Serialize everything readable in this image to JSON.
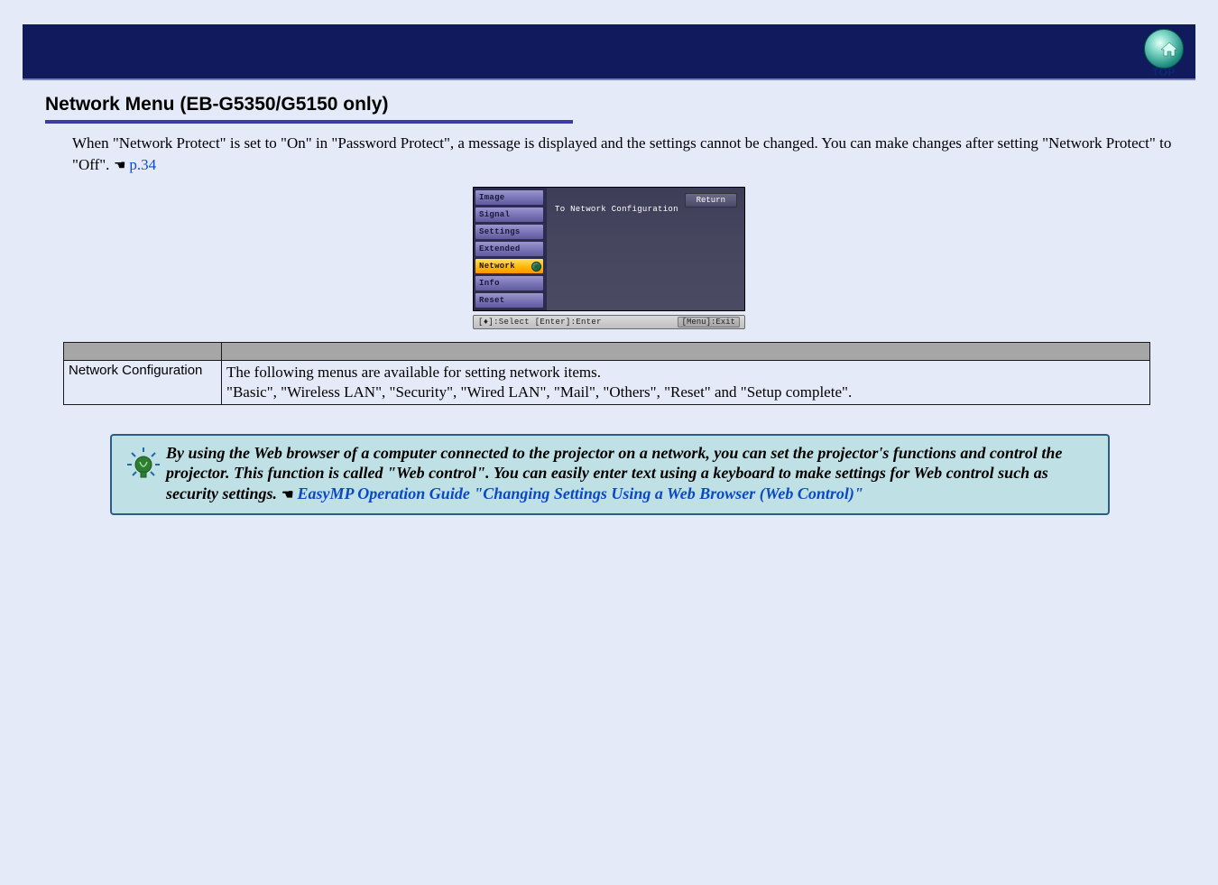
{
  "header": {
    "logo_label": "TOP"
  },
  "section": {
    "title": "Network Menu (EB-G5350/G5150 only)",
    "intro_before": "When \"Network Protect\" is set to \"On\" in \"Password Protect\", a message is displayed and the settings cannot be changed. You can make changes after setting \"Network Protect\" to \"Off\". ",
    "page_link": "p.34"
  },
  "projector_menu": {
    "tabs": [
      "Image",
      "Signal",
      "Settings",
      "Extended",
      "Network",
      "Info",
      "Reset"
    ],
    "active_tab": "Network",
    "right_label": "To Network Configuration",
    "return_label": "Return",
    "footer_left": "[♦]:Select [Enter]:Enter",
    "footer_right": "[Menu]:Exit"
  },
  "table": {
    "row1_col1": "Network Configuration",
    "row1_col2_line1": "The following menus are available for setting network items.",
    "row1_col2_line2": "\"Basic\", \"Wireless LAN\", \"Security\", \"Wired LAN\", \"Mail\", \"Others\", \"Reset\" and \"Setup complete\"."
  },
  "tip": {
    "text_before": "By using the Web browser of a computer connected to the projector on a network, you can set the projector's functions and control the projector. This function is called \"Web control\". You can easily enter text using a keyboard to make settings for Web control such as security settings. ",
    "link_text": "EasyMP Operation Guide \"Changing Settings Using a Web Browser (Web Control)\""
  }
}
